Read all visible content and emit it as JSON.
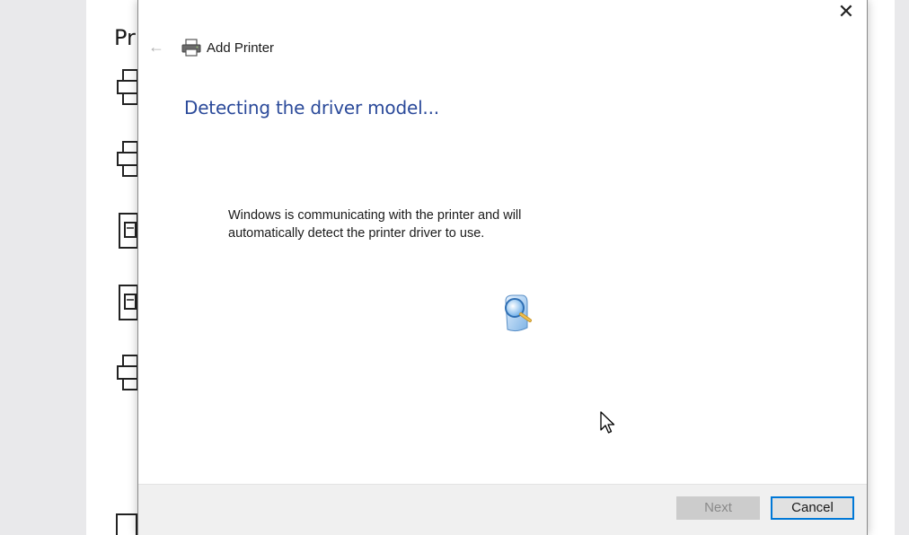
{
  "background_window": {
    "title_fragment": "Pr"
  },
  "dialog": {
    "title": "Add Printer",
    "heading": "Detecting the driver model...",
    "message_line1": "Windows is communicating with the printer and will",
    "message_line2": "automatically detect the printer driver to use.",
    "buttons": {
      "next": "Next",
      "cancel": "Cancel"
    },
    "close_glyph": "✕",
    "back_glyph": "←",
    "icons": {
      "title": "printer-icon",
      "progress": "searching-magnifier-icon"
    }
  },
  "colors": {
    "heading": "#2b4a9a",
    "accent_border": "#0078d7",
    "disabled_button": "#cccccc"
  }
}
